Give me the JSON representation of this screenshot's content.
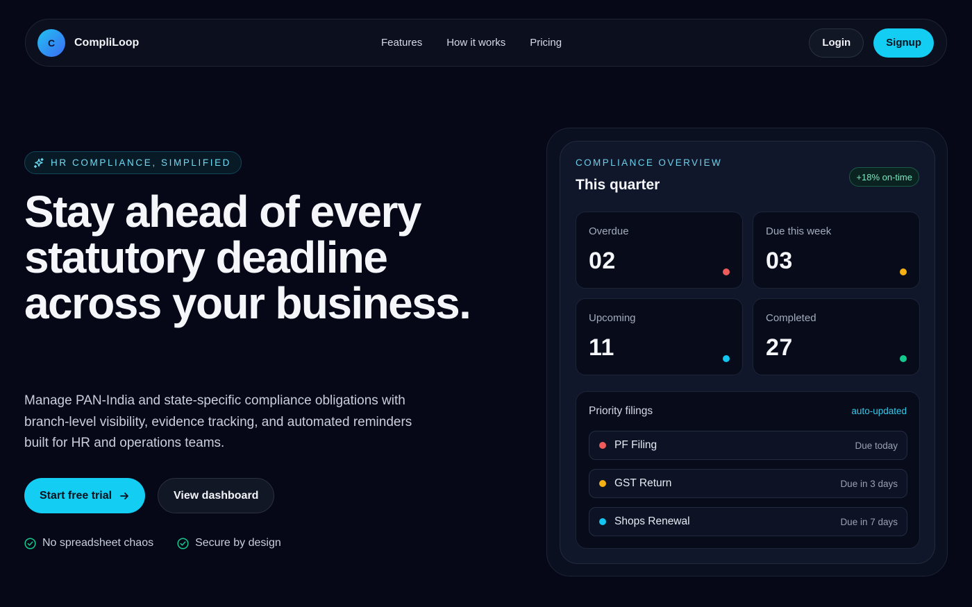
{
  "nav": {
    "logo_letter": "C",
    "brand": "CompliLoop",
    "links": [
      "Features",
      "How it works",
      "Pricing"
    ],
    "login_label": "Login",
    "signup_label": "Signup"
  },
  "hero": {
    "badge": "HR COMPLIANCE, SIMPLIFIED",
    "headline": "Stay ahead of every statutory deadline across your business.",
    "subtext": "Manage PAN-India and state-specific compliance obligations with branch-level visibility, evidence tracking, and automated reminders built for HR and operations teams.",
    "primary_cta": "Start free trial",
    "secondary_cta": "View dashboard",
    "checks": [
      "No spreadsheet chaos",
      "Secure by design"
    ]
  },
  "overview": {
    "label": "COMPLIANCE OVERVIEW",
    "title": "This quarter",
    "badge": "+18% on-time",
    "stats": [
      {
        "label": "Overdue",
        "value": "02",
        "color": "#ef5b5b"
      },
      {
        "label": "Due this week",
        "value": "03",
        "color": "#f5b014"
      },
      {
        "label": "Upcoming",
        "value": "11",
        "color": "#13c6f2"
      },
      {
        "label": "Completed",
        "value": "27",
        "color": "#14c98e"
      }
    ],
    "priority": {
      "title": "Priority filings",
      "auto_label": "auto-updated",
      "items": [
        {
          "name": "PF Filing",
          "due": "Due today",
          "color": "#ef5b5b"
        },
        {
          "name": "GST Return",
          "due": "Due in 3 days",
          "color": "#f5b014"
        },
        {
          "name": "Shops Renewal",
          "due": "Due in 7 days",
          "color": "#13c6f2"
        }
      ]
    }
  }
}
